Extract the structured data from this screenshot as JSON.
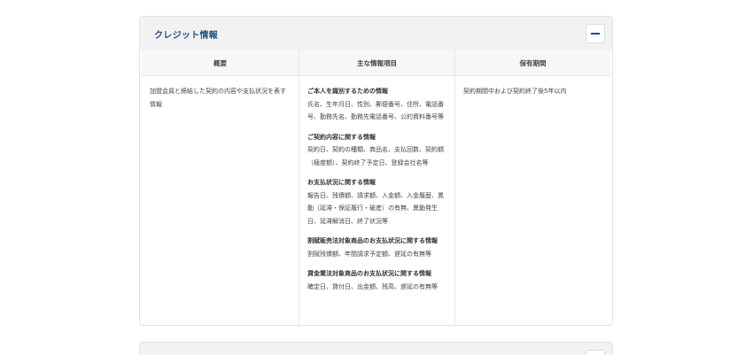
{
  "section": {
    "title": "クレジット情報",
    "columns": [
      "概要",
      "主な情報項目",
      "保有期間"
    ],
    "summary": "加盟会員と締結した契約の内容や支払状況を表す情報",
    "items": [
      {
        "title": "ご本人を識別するための情報",
        "detail": "氏名、生年月日、性別、郵便番号、住所、電話番号、勤務先名、勤務先電話番号、公的資料番号等"
      },
      {
        "title": "ご契約内容に関する情報",
        "detail": "契約日、契約の種類、商品名、支払回数、契約額（極度額）、契約終了予定日、登録会社名等"
      },
      {
        "title": "お支払状況に関する情報",
        "detail": "報告日、残債額、請求額、入金額、入金履歴、異動（延滞・保証履行・破産）の有無、異動発生日、延滞解消日、終了状況等"
      },
      {
        "title": "割賦販売法対象商品のお支払状況に関する情報",
        "detail": "割賦残債額、年間請求予定額、遅延の有無等"
      },
      {
        "title": "貸金業法対象商品のお支払状況に関する情報",
        "detail": "確定日、貸付日、出金額、残高、遅延の有無等"
      }
    ],
    "retention": "契約期間中および契約終了後5年以内"
  }
}
